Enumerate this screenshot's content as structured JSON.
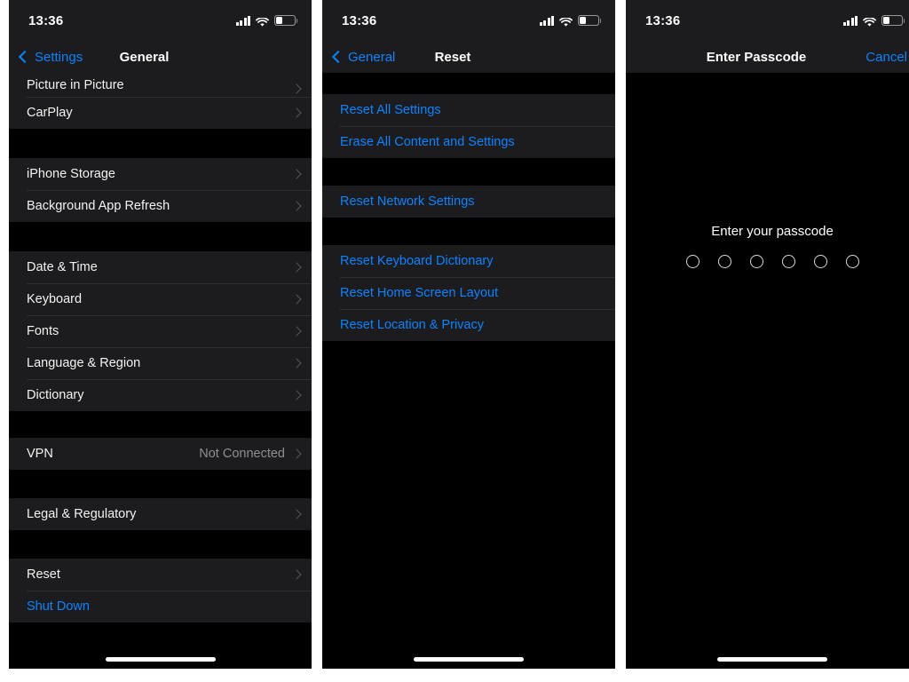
{
  "status_bar": {
    "time": "13:36",
    "icons": [
      "cellular-signal-icon",
      "wifi-icon",
      "battery-icon"
    ],
    "battery_level_percent": 32
  },
  "colors": {
    "accent_blue": "#0a84ff",
    "row_background": "#1c1c1e",
    "page_background": "#000000",
    "primary_text": "#f2f2f2",
    "secondary_text": "#8e8e93"
  },
  "panels": [
    {
      "id": "general-settings",
      "nav": {
        "back_label": "Settings",
        "title": "General",
        "right_label": ""
      },
      "sections": [
        {
          "rows": [
            {
              "label": "Picture in Picture",
              "value": "",
              "style": "default",
              "accessory": "chevron",
              "partial": true
            },
            {
              "label": "CarPlay",
              "value": "",
              "style": "default",
              "accessory": "chevron",
              "partial": false
            }
          ]
        },
        {
          "rows": [
            {
              "label": "iPhone Storage",
              "value": "",
              "style": "default",
              "accessory": "chevron",
              "partial": false
            },
            {
              "label": "Background App Refresh",
              "value": "",
              "style": "default",
              "accessory": "chevron",
              "partial": false
            }
          ]
        },
        {
          "rows": [
            {
              "label": "Date & Time",
              "value": "",
              "style": "default",
              "accessory": "chevron",
              "partial": false
            },
            {
              "label": "Keyboard",
              "value": "",
              "style": "default",
              "accessory": "chevron",
              "partial": false
            },
            {
              "label": "Fonts",
              "value": "",
              "style": "default",
              "accessory": "chevron",
              "partial": false
            },
            {
              "label": "Language & Region",
              "value": "",
              "style": "default",
              "accessory": "chevron",
              "partial": false
            },
            {
              "label": "Dictionary",
              "value": "",
              "style": "default",
              "accessory": "chevron",
              "partial": false
            }
          ]
        },
        {
          "rows": [
            {
              "label": "VPN",
              "value": "Not Connected",
              "style": "default",
              "accessory": "chevron",
              "partial": false
            }
          ]
        },
        {
          "rows": [
            {
              "label": "Legal & Regulatory",
              "value": "",
              "style": "default",
              "accessory": "chevron",
              "partial": false
            }
          ]
        },
        {
          "rows": [
            {
              "label": "Reset",
              "value": "",
              "style": "default",
              "accessory": "chevron",
              "partial": false
            },
            {
              "label": "Shut Down",
              "value": "",
              "style": "blue",
              "accessory": "none",
              "partial": false
            }
          ]
        }
      ]
    },
    {
      "id": "reset-menu",
      "nav": {
        "back_label": "General",
        "title": "Reset",
        "right_label": ""
      },
      "sections": [
        {
          "rows": [
            {
              "label": "Reset All Settings",
              "value": "",
              "style": "blue",
              "accessory": "none",
              "partial": false
            },
            {
              "label": "Erase All Content and Settings",
              "value": "",
              "style": "blue",
              "accessory": "none",
              "partial": false
            }
          ]
        },
        {
          "rows": [
            {
              "label": "Reset Network Settings",
              "value": "",
              "style": "blue",
              "accessory": "none",
              "partial": false
            }
          ]
        },
        {
          "rows": [
            {
              "label": "Reset Keyboard Dictionary",
              "value": "",
              "style": "blue",
              "accessory": "none",
              "partial": false
            },
            {
              "label": "Reset Home Screen Layout",
              "value": "",
              "style": "blue",
              "accessory": "none",
              "partial": false
            },
            {
              "label": "Reset Location & Privacy",
              "value": "",
              "style": "blue",
              "accessory": "none",
              "partial": false
            }
          ]
        }
      ]
    },
    {
      "id": "enter-passcode",
      "nav": {
        "back_label": "",
        "title": "Enter Passcode",
        "right_label": "Cancel"
      },
      "passcode": {
        "prompt": "Enter your passcode",
        "dot_count": 6,
        "filled_count": 0
      }
    }
  ]
}
